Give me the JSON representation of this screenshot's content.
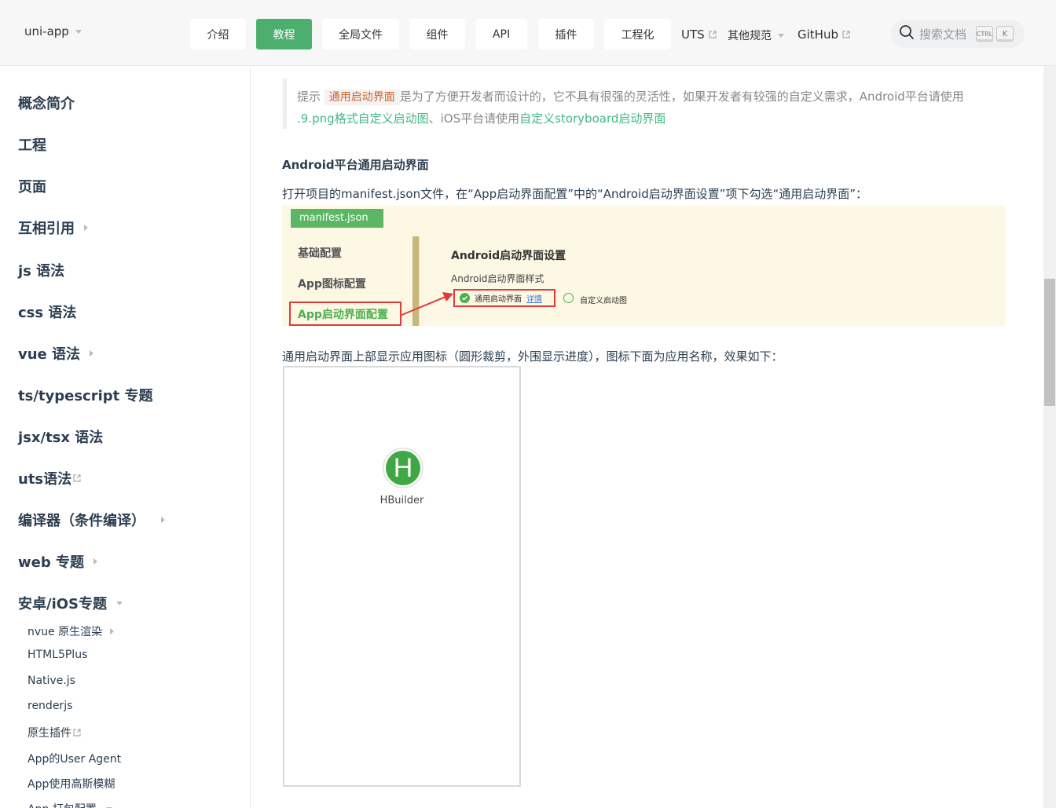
{
  "navbar": {
    "brand": "uni-app",
    "buttons": [
      "介绍",
      "教程",
      "全局文件",
      "组件",
      "API",
      "插件",
      "工程化"
    ],
    "links": {
      "uts": "UTS",
      "other": "其他规范",
      "github": "GitHub"
    },
    "search": {
      "placeholder": "搜索文档",
      "key1": "CTRL",
      "key2": "K"
    },
    "accent_color": "#4caf6e"
  },
  "sidebar": {
    "items": [
      "概念简介",
      "工程",
      "页面",
      "互相引用",
      "js 语法",
      "css 语法",
      "vue 语法",
      "ts/typescript 专题",
      "jsx/tsx 语法",
      "uts语法",
      "编译器（条件编译）",
      "web 专题",
      "安卓/iOS专题"
    ],
    "sub_items": [
      "nvue 原生渲染",
      "HTML5Plus",
      "Native.js",
      "renderjs",
      "原生插件",
      "App的User Agent",
      "App使用高斯模糊",
      "App 打包配置"
    ]
  },
  "content": {
    "tip": {
      "prefix": "提示",
      "code": "通用启动界面",
      "text1": "是为了方便开发者而设计的，它不具有很强的灵活性，如果开发者有较强的自定义需求，Android平台请使用",
      "link1": ".9.png格式自定义启动图",
      "text2": "、iOS平台请使用",
      "link2": "自定义storyboard启动界面"
    },
    "heading": "Android平台通用启动界面",
    "para1": "打开项目的manifest.json文件，在“App启动界面配置”中的“Android启动界面设置”项下勾选“通用启动界面”：",
    "screenshot": {
      "tab": "manifest.json",
      "menu": [
        "基础配置",
        "App图标配置",
        "App启动界面配置"
      ],
      "section_title": "Android启动界面设置",
      "style_label": "Android启动界面样式",
      "option1": "通用启动界面",
      "detail_link": "详情",
      "option2": "自定义启动图"
    },
    "para2": "通用启动界面上部显示应用图标（圆形裁剪，外围显示进度），图标下面为应用名称，效果如下：",
    "phone": {
      "icon_letter": "H",
      "app_name": "HBuilder"
    }
  }
}
